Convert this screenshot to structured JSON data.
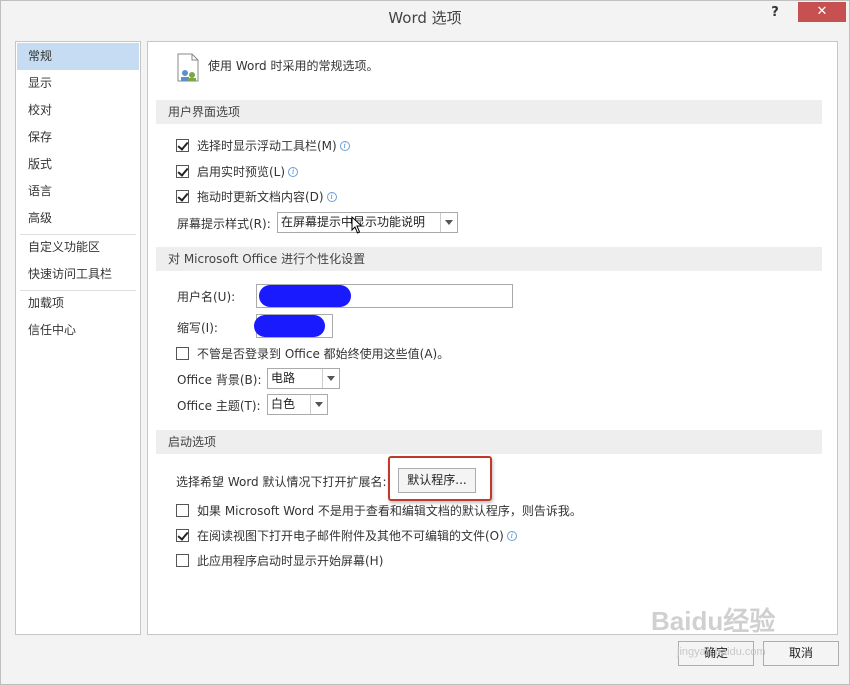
{
  "window": {
    "title": "Word 选项",
    "help": "?",
    "close": "✕"
  },
  "sidebar": {
    "items": [
      {
        "label": "常规"
      },
      {
        "label": "显示"
      },
      {
        "label": "校对"
      },
      {
        "label": "保存"
      },
      {
        "label": "版式"
      },
      {
        "label": "语言"
      },
      {
        "label": "高级"
      },
      {
        "label": "自定义功能区"
      },
      {
        "label": "快速访问工具栏"
      },
      {
        "label": "加载项"
      },
      {
        "label": "信任中心"
      }
    ]
  },
  "intro": {
    "text": "使用 Word 时采用的常规选项。",
    "icon": "general-options-icon"
  },
  "ui_options": {
    "header": "用户界面选项",
    "show_minitoolbar": {
      "label": "选择时显示浮动工具栏(M)",
      "checked": true
    },
    "live_preview": {
      "label": "启用实时预览(L)",
      "checked": true
    },
    "update_on_drag": {
      "label": "拖动时更新文档内容(D)",
      "checked": true
    },
    "screentip_label": "屏幕提示样式(R):",
    "screentip_value": "在屏幕提示中显示功能说明"
  },
  "personalize": {
    "header": "对 Microsoft Office 进行个性化设置",
    "username_label": "用户名(U):",
    "initials_label": "缩写(I):",
    "always_use": {
      "label": "不管是否登录到 Office 都始终使用这些值(A)。",
      "checked": false
    },
    "background_label": "Office 背景(B):",
    "background_value": "电路",
    "theme_label": "Office 主题(T):",
    "theme_value": "白色"
  },
  "startup": {
    "header": "启动选项",
    "choose_ext_label": "选择希望 Word 默认情况下打开扩展名:",
    "default_programs_button": "默认程序...",
    "tell_me": {
      "label": "如果 Microsoft Word 不是用于查看和编辑文档的默认程序，则告诉我。",
      "checked": false
    },
    "reading_view": {
      "label": "在阅读视图下打开电子邮件附件及其他不可编辑的文件(O)",
      "checked": true
    },
    "show_start_screen": {
      "label": "此应用程序启动时显示开始屏幕(H)",
      "checked": false
    }
  },
  "footer": {
    "ok": "确定",
    "cancel": "取消"
  },
  "watermark": {
    "brand": "Baidu经验",
    "url": "jingyan.baidu.com"
  },
  "colors": {
    "nav_active": "#c5dcf2",
    "close": "#c75050",
    "highlight": "#c0392b",
    "redaction": "#1a1aff"
  }
}
